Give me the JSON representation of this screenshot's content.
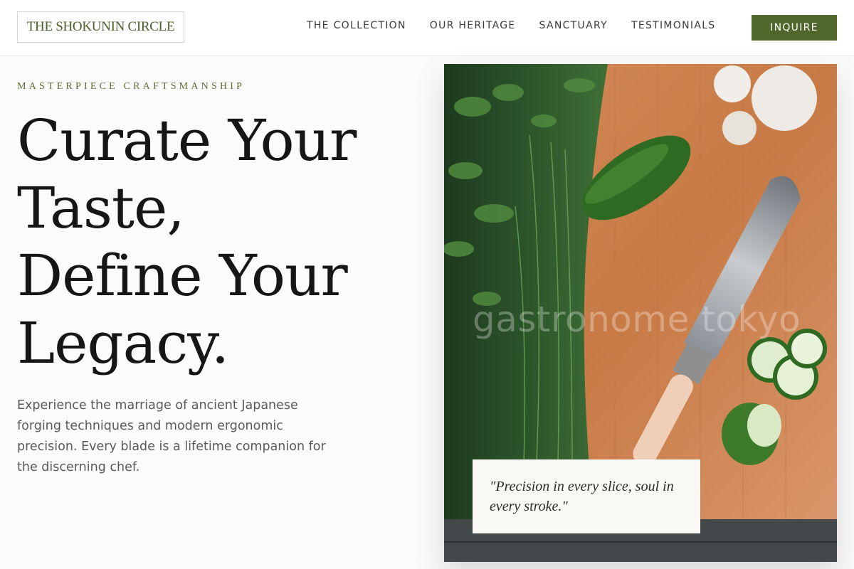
{
  "header": {
    "logo": "THE SHOKUNIN CIRCLE",
    "nav": [
      "THE COLLECTION",
      "OUR HERITAGE",
      "SANCTUARY",
      "TESTIMONIALS"
    ],
    "cta": "INQUIRE"
  },
  "hero": {
    "eyebrow": "MASTERPIECE CRAFTSMANSHIP",
    "headline": [
      "Curate Your",
      "Taste,",
      "Define Your",
      "Legacy."
    ],
    "lede": "Experience the marriage of ancient Japanese forging techniques and modern ergonomic precision. Every blade is a lifetime companion for the discerning chef."
  },
  "image": {
    "watermark": "gastronome tokyo",
    "quote": "\"Precision in every slice, soul in every stroke.\""
  },
  "colors": {
    "brand_green": "#4f672b",
    "background": "#fbfbfb",
    "text": "#161616",
    "body_text": "#5a5a5a"
  }
}
